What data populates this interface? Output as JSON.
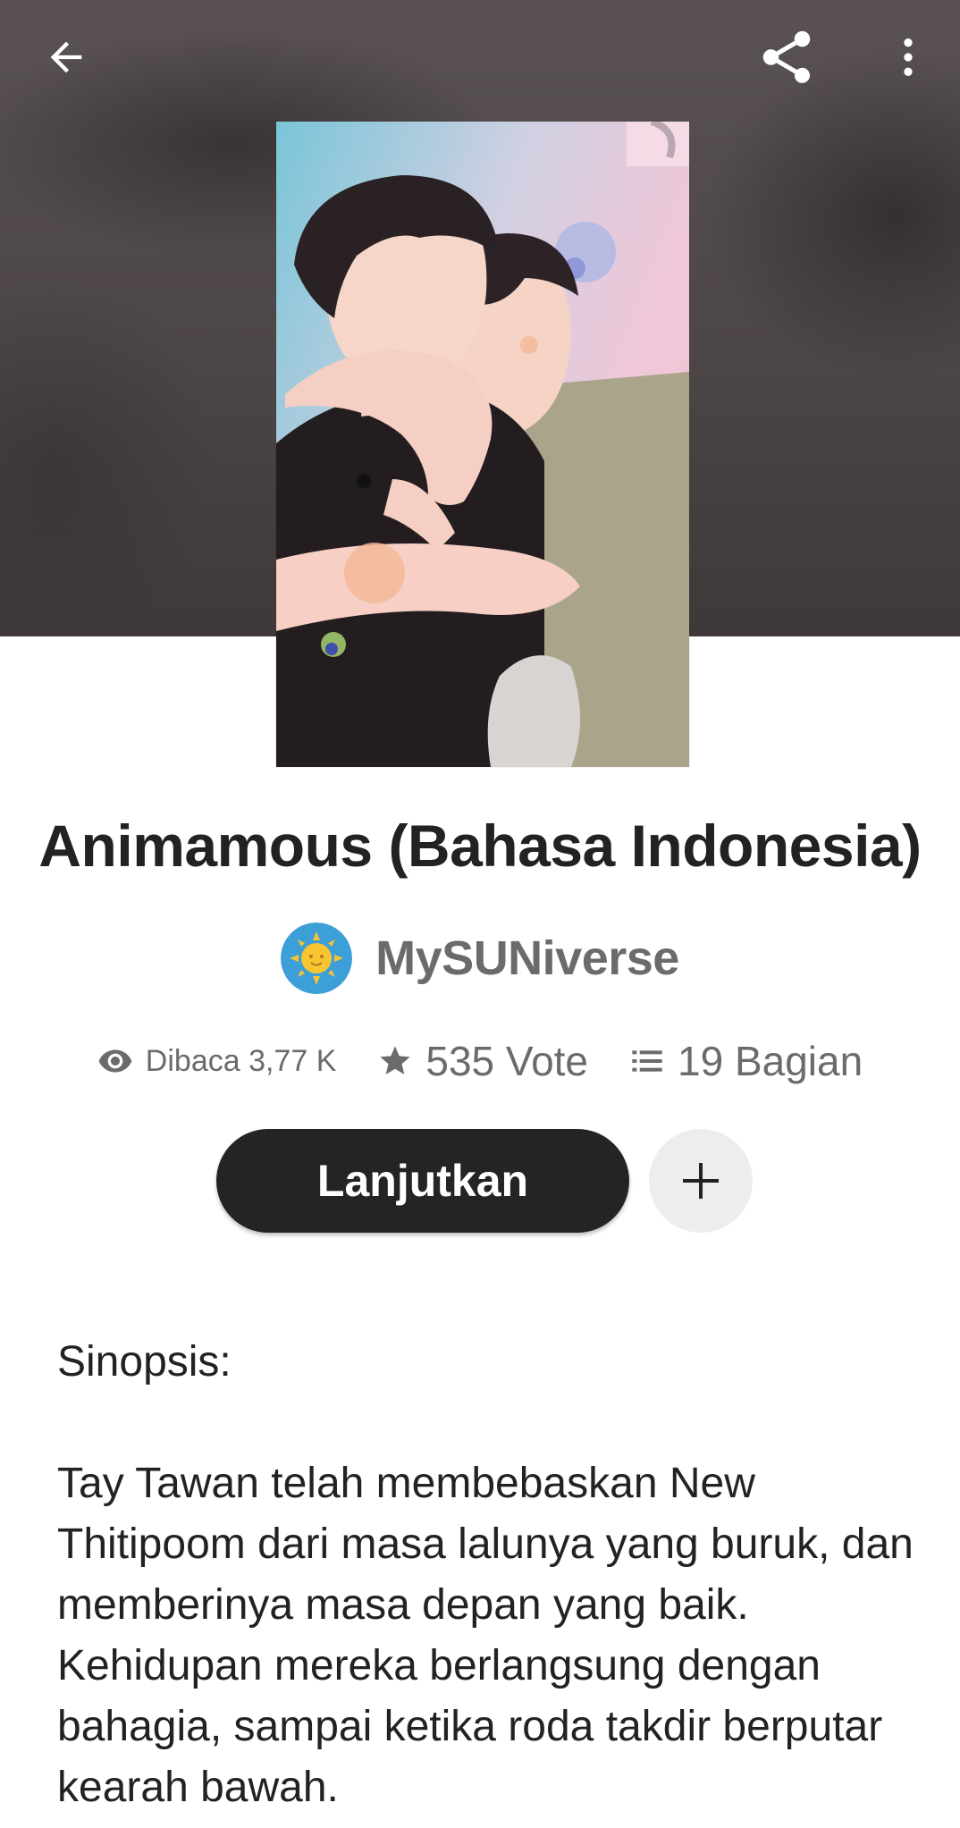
{
  "header": {
    "back_icon": "arrow-left-icon",
    "share_icon": "share-icon",
    "more_icon": "more-vertical-icon"
  },
  "story": {
    "title": "Animamous (Bahasa Indonesia)",
    "author": "MySUNiverse",
    "stats": {
      "reads": "Dibaca 3,77 K",
      "votes": "535 Vote",
      "parts": "19 Bagian"
    },
    "continue_label": "Lanjutkan",
    "add_icon": "plus-icon"
  },
  "synopsis": {
    "heading": "Sinopsis:",
    "body": "Tay Tawan telah membebaskan New Thitipoom dari masa lalunya yang buruk, dan memberinya masa depan yang baik. Kehidupan mereka berlangsung dengan bahagia, sampai ketika roda takdir berputar kearah bawah."
  },
  "colors": {
    "button_dark": "#242424",
    "author_gray": "#6b6b6b",
    "text": "#222222"
  }
}
